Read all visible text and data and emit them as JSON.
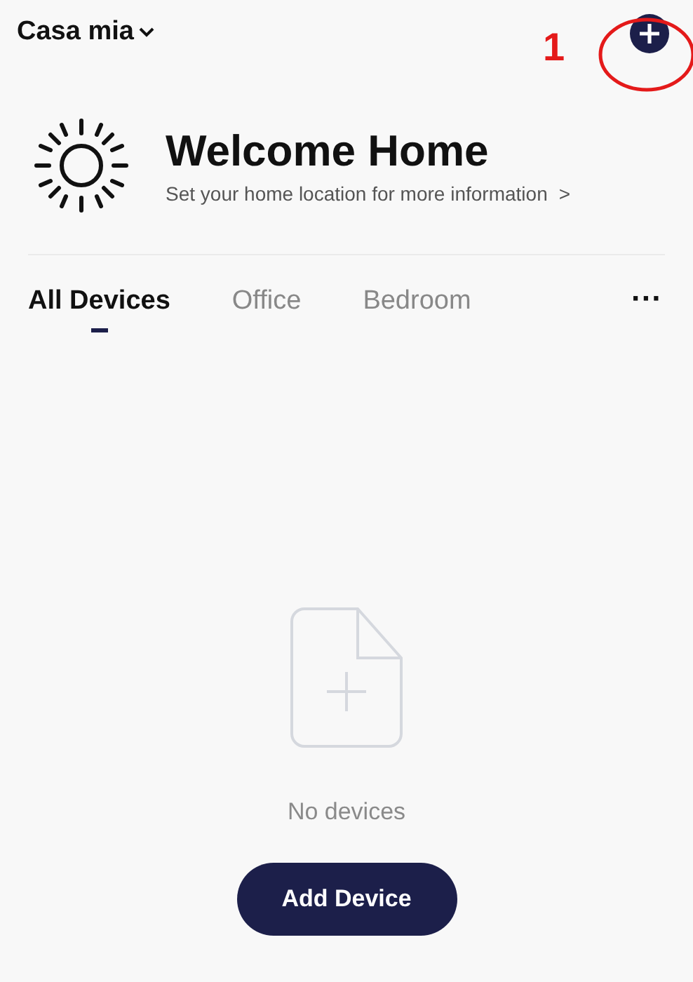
{
  "header": {
    "home_name": "Casa mia"
  },
  "annotation": {
    "label": "1"
  },
  "welcome": {
    "title": "Welcome Home",
    "subtitle": "Set your home location for more information",
    "subtitle_arrow": ">"
  },
  "tabs": [
    {
      "label": "All Devices",
      "selected": true
    },
    {
      "label": "Office",
      "selected": false
    },
    {
      "label": "Bedroom",
      "selected": false
    }
  ],
  "more_menu": "···",
  "empty_state": {
    "message": "No devices",
    "button": "Add Device"
  }
}
